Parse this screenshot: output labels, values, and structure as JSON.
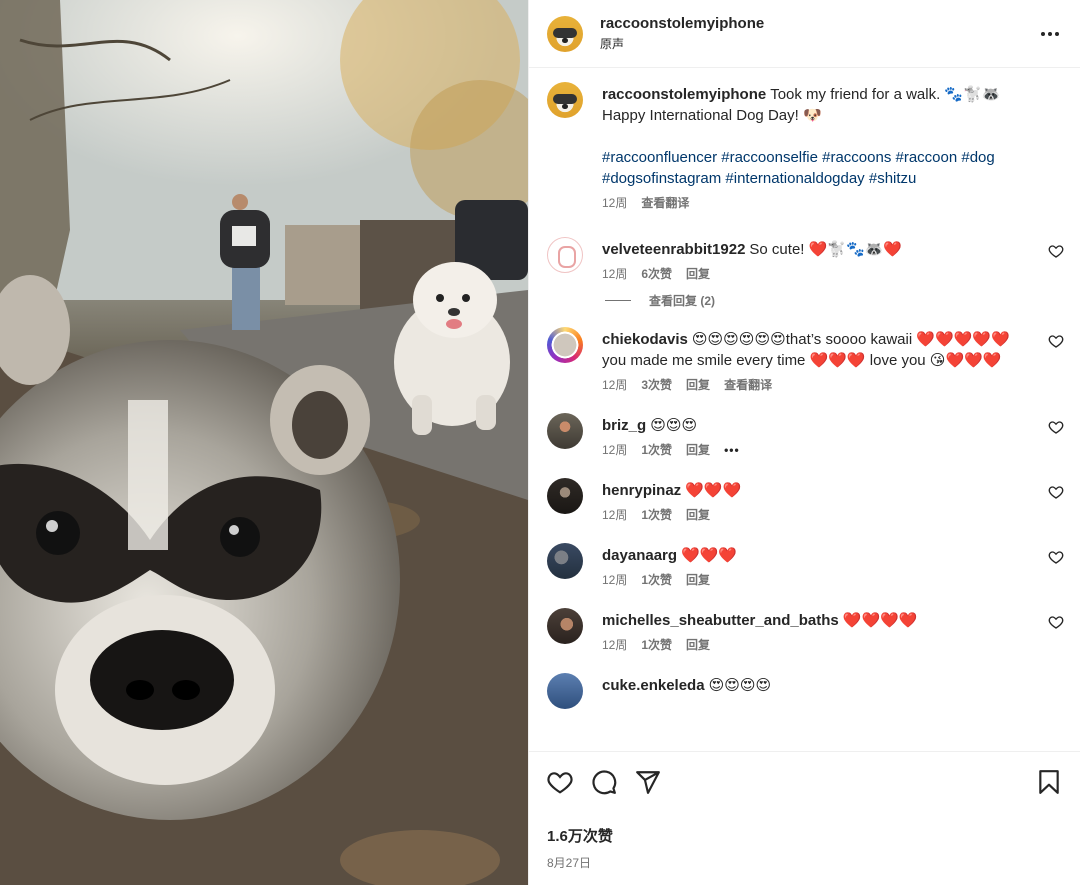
{
  "post": {
    "author": "raccoonstolemyiphone",
    "location": "原声",
    "caption_text": "Took my friend for a walk. 🐾🐩🦝 Happy International Dog Day! 🐶",
    "hashtags": "#raccoonfluencer #raccoonselfie #raccoons #raccoon #dog #dogsofinstagram #internationaldogday #shitzu",
    "caption_time": "12周",
    "caption_translate": "查看翻译",
    "likes": "1.6万次赞",
    "date": "8月27日"
  },
  "icons": {
    "more": "more-horizontal-icon",
    "like": "heart-outline-icon",
    "comment": "comment-bubble-icon",
    "share": "paper-plane-icon",
    "save": "bookmark-icon"
  },
  "comments": [
    {
      "user": "velveteenrabbit1922",
      "text": "So cute! ❤️🐩🐾🦝❤️",
      "time": "12周",
      "likes": "6次赞",
      "reply": "回复",
      "view_replies": "查看回复 (2)"
    },
    {
      "user": "chiekodavis",
      "text": "😍😍😍😍😍😍that’s soooo kawaii ❤️❤️❤️❤️❤️ you made me smile every time ❤️❤️❤️ love you 😘❤️❤️❤️",
      "time": "12周",
      "likes": "3次赞",
      "reply": "回复",
      "translate": "查看翻译"
    },
    {
      "user": "briz_g",
      "text": "😍😍😍",
      "time": "12周",
      "likes": "1次赞",
      "reply": "回复",
      "more": "•••"
    },
    {
      "user": "henrypinaz",
      "text": "❤️❤️❤️",
      "time": "12周",
      "likes": "1次赞",
      "reply": "回复"
    },
    {
      "user": "dayanaarg",
      "text": "❤️❤️❤️",
      "time": "12周",
      "likes": "1次赞",
      "reply": "回复"
    },
    {
      "user": "michelles_sheabutter_and_baths",
      "text": "❤️❤️❤️❤️",
      "time": "12周",
      "likes": "1次赞",
      "reply": "回复"
    },
    {
      "user": "cuke.enkeleda",
      "text": "😍😍😍😍"
    }
  ]
}
